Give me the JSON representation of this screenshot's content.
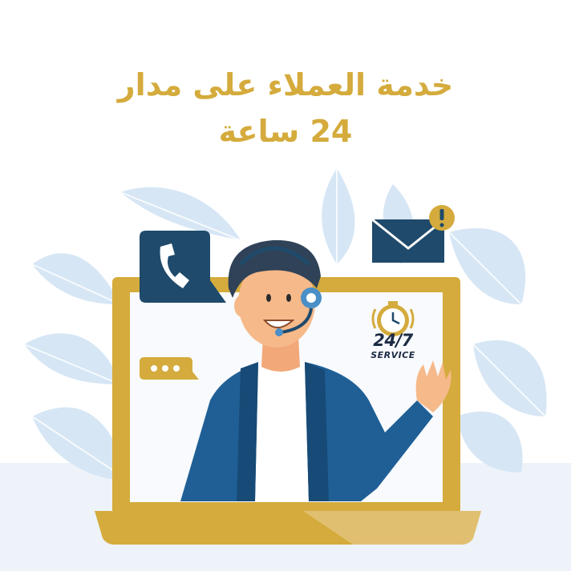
{
  "headline": {
    "line1": "خدمة العملاء على مدار",
    "line2": "24  ساعة"
  },
  "badge": {
    "main": "24/7",
    "sub": "SERVICE"
  },
  "colors": {
    "gold": "#d4ab3c",
    "navy": "#1f4a6b",
    "jacket": "#1f5f96",
    "leaf": "#d6e6f5",
    "floor": "#eef3f9",
    "skin": "#f6b98a"
  },
  "icons": [
    "phone-icon",
    "envelope-icon",
    "alert-icon",
    "chat-dots-icon",
    "stopwatch-icon",
    "headset-icon"
  ]
}
